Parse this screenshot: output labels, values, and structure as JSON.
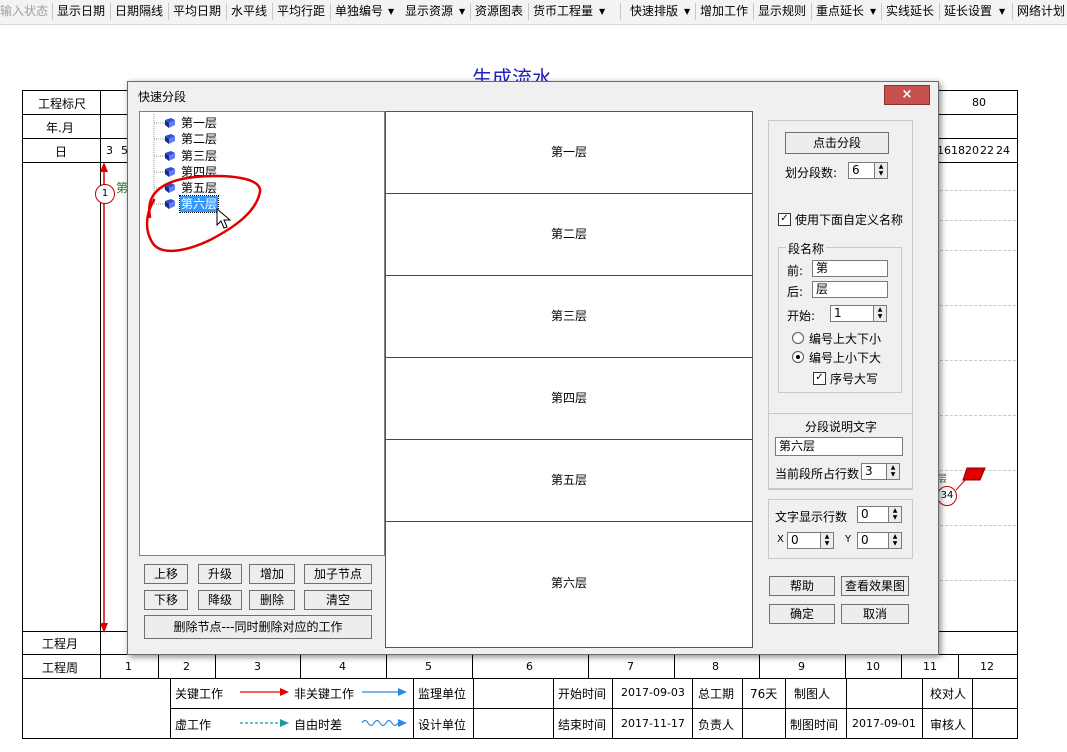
{
  "toolbar": {
    "items": [
      "输入状态",
      "显示日期",
      "日期隔线",
      "平均日期",
      "水平线",
      "平均行距",
      "单独编号",
      "显示资源",
      "资源图表",
      "货币工程量",
      "快速排版",
      "增加工作",
      "显示规则",
      "重点延长",
      "实线延长",
      "延长设置",
      "网络计划"
    ]
  },
  "chart": {
    "title": "生成流水",
    "row_labels": [
      "工程标尺",
      "年.月",
      "日",
      "工程月",
      "工程周"
    ],
    "scale_right": "80",
    "day_left": [
      "3",
      "5"
    ],
    "day_right": [
      "16",
      "18",
      "20",
      "22",
      "24"
    ],
    "node_left": "1",
    "node_right": "34",
    "left_partial": "第",
    "right_partial": "层",
    "weeks": [
      "1",
      "2",
      "3",
      "4",
      "5",
      "6",
      "7",
      "8",
      "9",
      "10",
      "11",
      "12"
    ]
  },
  "footer": {
    "key_work": "关键工作",
    "non_key_work": "非关键工作",
    "virtual_work": "虚工作",
    "free_float": "自由时差",
    "supervisor": "监理单位",
    "designer": "设计单位",
    "start_time": "开始时间",
    "start_value": "2017-09-03",
    "end_time": "结束时间",
    "end_value": "2017-11-17",
    "total_period": "总工期",
    "total_value": "76天",
    "responsible": "负责人",
    "drawer": "制图人",
    "draw_time": "制图时间",
    "draw_time_value": "2017-09-01",
    "proofreader": "校对人",
    "reviewer": "审核人"
  },
  "colors": {
    "key_arrow": "#e00000",
    "nonkey_arrow": "#2a8ce0",
    "seg_border": "#d01010",
    "title": "#2020c0",
    "annotation": "#e00000"
  },
  "dialog": {
    "title": "快速分段",
    "close_icon": "×",
    "tree": [
      "第一层",
      "第二层",
      "第三层",
      "第四层",
      "第五层",
      "第六层"
    ],
    "selected_index": 5,
    "segments": [
      "第一层",
      "第二层",
      "第三层",
      "第四层",
      "第五层",
      "第六层"
    ],
    "buttons": {
      "up": "上移",
      "promote": "升级",
      "add": "增加",
      "add_child": "加子节点",
      "down": "下移",
      "demote": "降级",
      "delete": "删除",
      "clear": "清空",
      "delete_node": "删除节点---同时删除对应的工作"
    },
    "split_button": "点击分段",
    "split_count_label": "划分段数:",
    "split_count_value": "6",
    "custom_name_label": "使用下面自定义名称",
    "segment_name_group": "段名称",
    "prefix_label": "前:",
    "prefix_value": "第",
    "suffix_label": "后:",
    "suffix_value": "层",
    "start_label": "开始:",
    "start_value": "1",
    "radio_top_large": "编号上大下小",
    "radio_top_small": "编号上小下大",
    "uppercase_label": "序号大写",
    "desc_group": "分段说明文字",
    "desc_value": "第六层",
    "rows_label": "当前段所占行数",
    "rows_value": "3",
    "text_rows_label": "文字显示行数",
    "text_rows_value": "0",
    "x_label": "X",
    "x_value": "0",
    "y_label": "Y",
    "y_value": "0",
    "help": "帮助",
    "preview": "查看效果图",
    "ok": "确定",
    "cancel": "取消"
  }
}
